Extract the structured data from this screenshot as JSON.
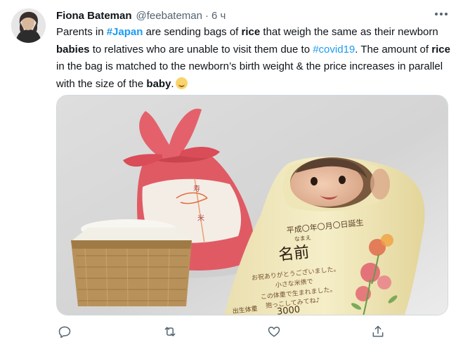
{
  "tweet": {
    "author_name": "Fiona Bateman",
    "author_handle": "@feebateman",
    "separator": "·",
    "time": "6 ч",
    "text": {
      "p1": "Parents in ",
      "tag_japan": "#Japan",
      "p2": " are sending bags of ",
      "rice1": "rice",
      "p3": " that weigh the same as their newborn ",
      "babies": "babies",
      "p4": " to relatives who are unable to visit them due to ",
      "tag_covid": "#covid19",
      "p5": ". The amount of ",
      "rice2": "rice",
      "p6": " in the bag is matched to the newborn’s birth weight & the price increases in parallel with the size of the ",
      "baby": "baby",
      "p7": "."
    },
    "media": {
      "bag_label_top": "平成〇年〇月〇日誕生",
      "bag_label_furigana": "なまえ",
      "bag_label_name": "名前",
      "bag_message_1": "お祝ありがとうございました。",
      "bag_message_2": "小さな米俵で",
      "bag_message_3": "この体重で生まれました。",
      "bag_message_4": "抱っこしてみてね♪",
      "bag_weight_label": "出生体重",
      "bag_weight_value": "3000",
      "red_bag_tag_1": "寿",
      "red_bag_tag_2": "米"
    }
  },
  "icons": [
    "avatar",
    "more-icon",
    "reply-icon",
    "retweet-icon",
    "like-icon",
    "share-icon",
    "baby-emoji-icon"
  ],
  "colors": {
    "link": "#1d9bf0",
    "muted": "#536471",
    "text": "#0f1419",
    "border": "#cfd9de"
  }
}
